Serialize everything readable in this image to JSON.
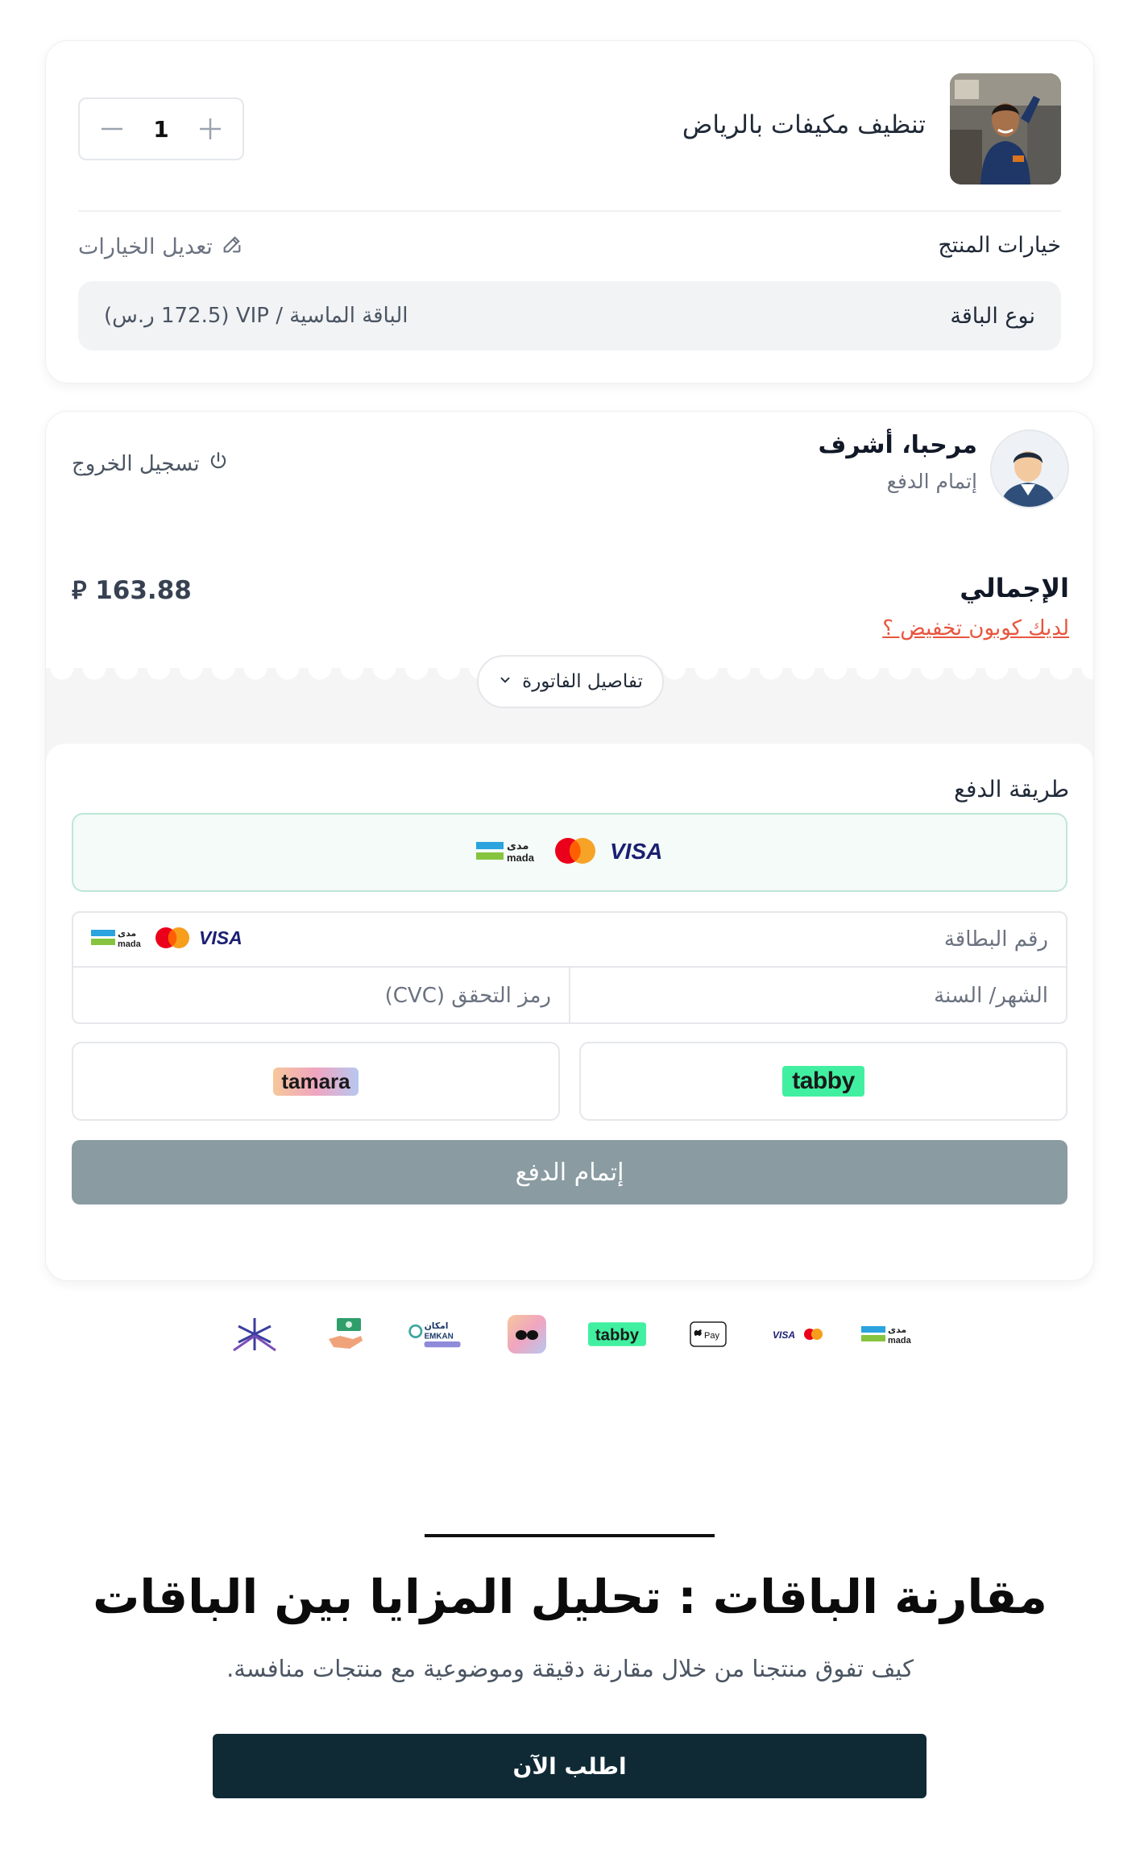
{
  "product": {
    "name": "تنظيف مكيفات بالرياض",
    "quantity": "1",
    "options_title": "خيارات المنتج",
    "edit_options_label": "تعديل الخيارات",
    "option_label": "نوع الباقة",
    "option_value": "الباقة الماسية / VIP (172.5 ر.س)"
  },
  "user": {
    "greeting": "مرحبا، أشرف",
    "step": "إتمام الدفع",
    "logout_label": "تسجيل الخروج"
  },
  "summary": {
    "total_label": "الإجمالي",
    "total_value": "⃁ 163.88",
    "coupon_label": "لديك كوبون تخفيض ؟",
    "invoice_details_label": "تفاصيل الفاتورة"
  },
  "payment": {
    "title": "طريقة الدفع",
    "card_number_placeholder": "رقم البطاقة",
    "expiry_placeholder": "الشهر/ السنة",
    "cvc_placeholder": "رمز التحقق (CVC)",
    "tabby_label": "tabby",
    "tamara_label": "tamara",
    "submit_label": "إتمام الدفع",
    "card_brands": {
      "visa": "VISA",
      "mada_ar": "مدى",
      "mada_en": "mada"
    }
  },
  "brand_strip": {
    "tabby": "tabby",
    "apple_pay": "Pay",
    "visa": "VISA",
    "mada_ar": "مدى",
    "mada_en": "mada",
    "emkan_ar": "امكان",
    "emkan_en": "EMKAN"
  },
  "comparison": {
    "title": "مقارنة الباقات : تحليل المزايا بين الباقات",
    "subtitle": "كيف تفوق منتجنا من خلال مقارنة دقيقة وموضوعية مع منتجات منافسة.",
    "cta_label": "اطلب الآن"
  },
  "colors": {
    "accent_dark": "#0f2a35",
    "coupon": "#e8553d",
    "submit_disabled": "#8a9ba1",
    "tabby_green": "#40f0a0"
  }
}
